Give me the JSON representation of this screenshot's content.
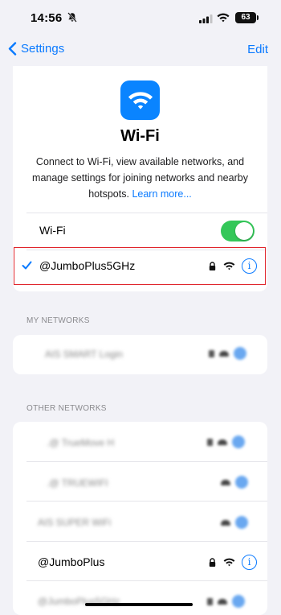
{
  "status_bar": {
    "time": "14:56",
    "battery": "63"
  },
  "nav": {
    "back_label": "Settings",
    "edit_label": "Edit"
  },
  "header": {
    "title": "Wi-Fi",
    "description": "Connect to Wi-Fi, view available networks, and manage settings for joining networks and nearby hotspots.",
    "learn_more": "Learn more..."
  },
  "wifi_toggle": {
    "label": "Wi-Fi",
    "on": true
  },
  "connected_network": {
    "name": "@JumboPlus5GHz",
    "locked": true
  },
  "my_networks": {
    "header": "MY NETWORKS",
    "items": [
      {
        "name": "AIS SMART Login",
        "blurred": true,
        "locked": true
      }
    ]
  },
  "other_networks": {
    "header": "OTHER NETWORKS",
    "items": [
      {
        "name": ".@ TrueMove H",
        "blurred": true,
        "locked": true
      },
      {
        "name": ".@ TRUEWIFI",
        "blurred": true,
        "locked": false
      },
      {
        "name": "AIS SUPER WiFi",
        "blurred": true,
        "locked": false
      },
      {
        "name": "@JumboPlus",
        "blurred": false,
        "locked": true
      },
      {
        "name": "@JumboPlus5GHz",
        "blurred": true,
        "locked": true
      }
    ]
  },
  "colors": {
    "accent": "#0a7aff",
    "toggle_on": "#34c759",
    "highlight": "#e0242b"
  }
}
